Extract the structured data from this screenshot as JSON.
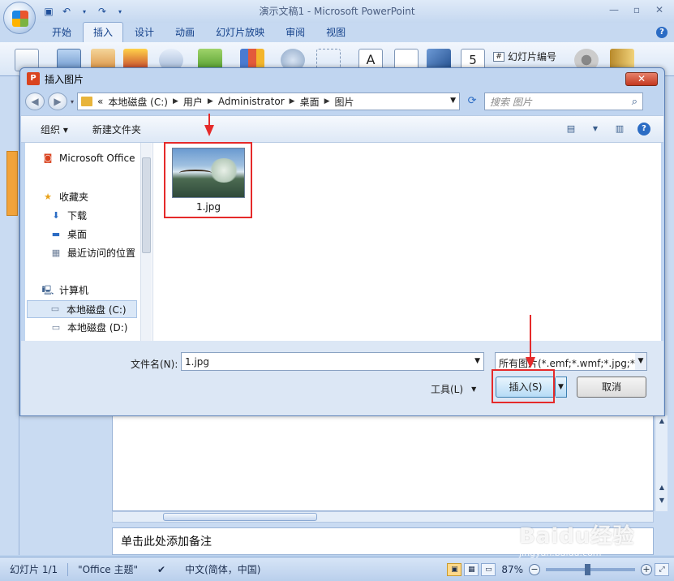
{
  "app": {
    "title": "演示文稿1 - Microsoft PowerPoint",
    "ribbon_tabs": [
      "开始",
      "插入",
      "设计",
      "动画",
      "幻灯片放映",
      "审阅",
      "视图"
    ],
    "active_tab": "插入",
    "ribbon_slide_number": "幻灯片编号",
    "ribbon_slide_number_digit": "5",
    "ribbon_text_a": "A"
  },
  "dialog": {
    "title": "插入图片",
    "breadcrumb": [
      "本地磁盘 (C:)",
      "用户",
      "Administrator",
      "桌面",
      "图片"
    ],
    "breadcrumb_prefix": "«",
    "search_placeholder": "搜索 图片",
    "toolbar": {
      "organize": "组织",
      "new_folder": "新建文件夹"
    },
    "nav": {
      "office": "Microsoft Office",
      "favorites": "收藏夹",
      "downloads": "下载",
      "desktop": "桌面",
      "recent": "最近访问的位置",
      "computer": "计算机",
      "drive_c": "本地磁盘 (C:)",
      "drive_d": "本地磁盘 (D:)"
    },
    "files": [
      {
        "name": "1.jpg"
      }
    ],
    "filename_label": "文件名(N):",
    "filename_value": "1.jpg",
    "filter_value": "所有图片(*.emf;*.wmf;*.jpg;*.jpeg",
    "tools_label": "工具(L)",
    "insert_label": "插入(S)",
    "cancel_label": "取消"
  },
  "notes_placeholder": "单击此处添加备注",
  "status": {
    "slide": "幻灯片 1/1",
    "theme": "\"Office 主题\"",
    "language": "中文(简体，中国)",
    "zoom": "87%"
  },
  "watermark": {
    "main": "Baidu经验",
    "sub": "jingyan.baidu.com"
  },
  "colors": {
    "annotation": "#e52a2a",
    "accent": "#2b6cc4"
  }
}
